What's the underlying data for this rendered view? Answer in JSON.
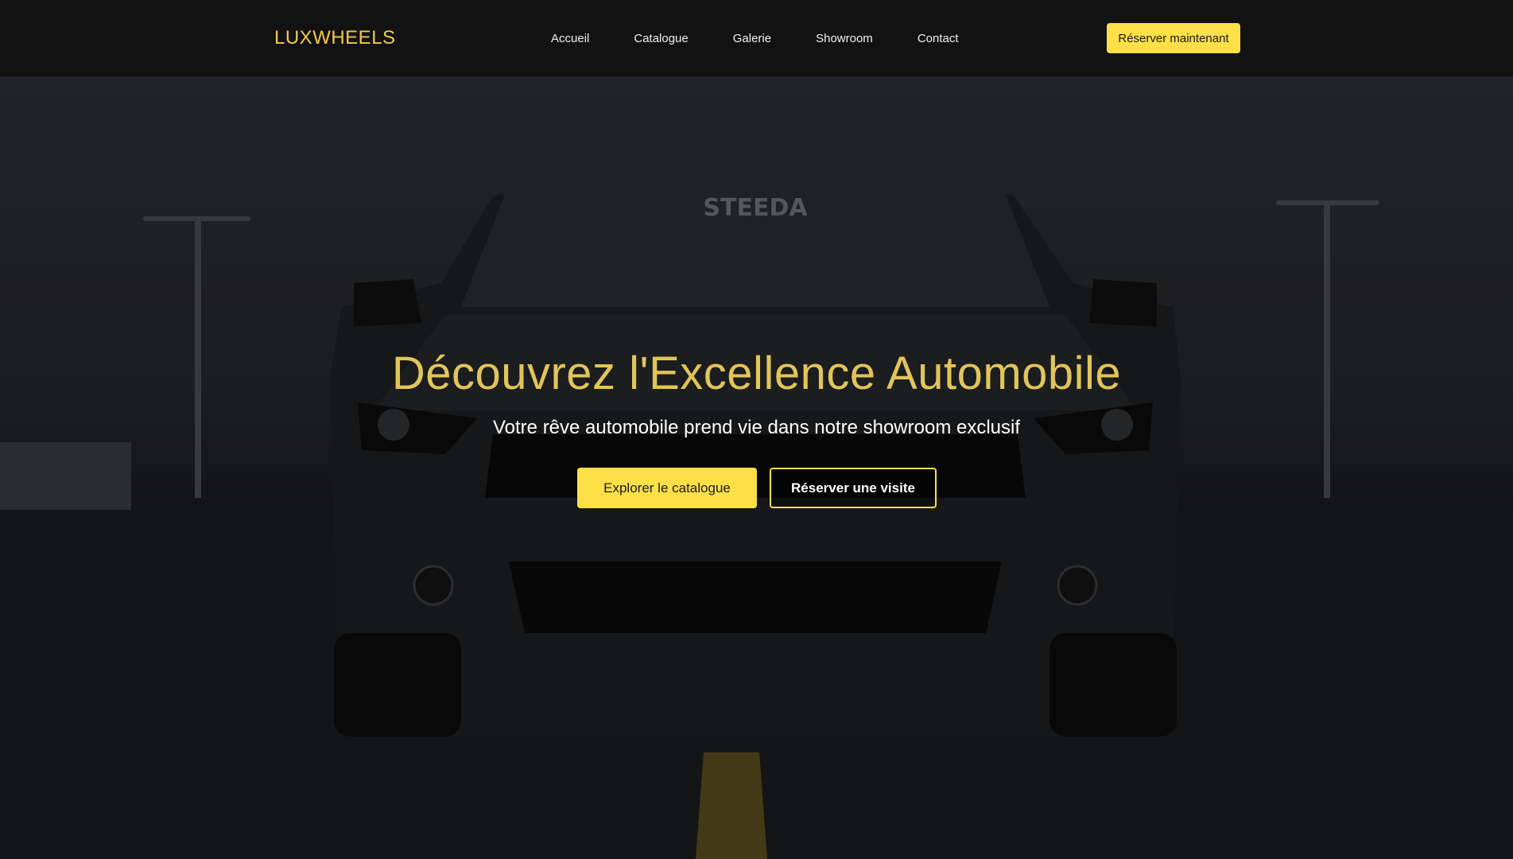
{
  "brand": {
    "name": "LUXWHEELS",
    "color": "#f2c94c"
  },
  "nav": {
    "items": [
      {
        "label": "Accueil"
      },
      {
        "label": "Catalogue"
      },
      {
        "label": "Galerie"
      },
      {
        "label": "Showroom"
      },
      {
        "label": "Contact"
      }
    ],
    "cta_label": "Réserver maintenant"
  },
  "hero": {
    "title": "Découvrez l'Excellence Automobile",
    "subtitle": "Votre rêve automobile prend vie dans notre showroom exclusif",
    "primary_button": "Explorer le catalogue",
    "secondary_button": "Réserver une visite",
    "windshield_text": "STEEDA"
  },
  "colors": {
    "accent": "#fde047",
    "title": "#e2c559",
    "nav_bg": "#121212"
  }
}
